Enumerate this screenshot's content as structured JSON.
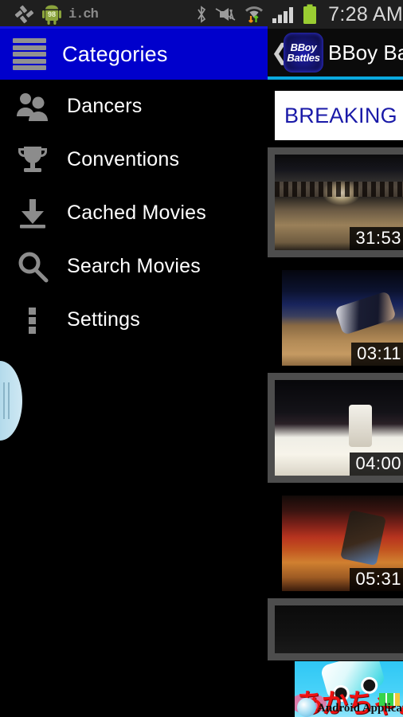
{
  "status_bar": {
    "clock": "7:28 AM",
    "left_icons": [
      {
        "name": "gps-satellite-icon",
        "glyph": "✂"
      },
      {
        "name": "android-update-icon",
        "label": "98"
      },
      {
        "name": "ich-app-icon",
        "label": "i.ch"
      }
    ],
    "right_icons": [
      {
        "name": "bluetooth-icon"
      },
      {
        "name": "vibrate-mute-icon"
      },
      {
        "name": "wifi-transfer-icon"
      },
      {
        "name": "cellular-signal-icon"
      },
      {
        "name": "battery-icon"
      }
    ]
  },
  "sidebar": {
    "title": "Categories",
    "menu_icon": "hamburger-icon",
    "handle": "drawer-pull-handle",
    "items": [
      {
        "label": "Dancers",
        "icon": "people-icon"
      },
      {
        "label": "Conventions",
        "icon": "trophy-icon"
      },
      {
        "label": "Cached Movies",
        "icon": "download-icon"
      },
      {
        "label": "Search Movies",
        "icon": "search-icon"
      },
      {
        "label": "Settings",
        "icon": "vertical-dots-icon"
      }
    ]
  },
  "content": {
    "back_chevron": "❮",
    "app_icon_line1": "BBoy",
    "app_icon_line2": "Battles",
    "title": "BBoy Bat",
    "banner_text": "BREAKING B",
    "videos": [
      {
        "duration": "31:53",
        "thumb": "t1"
      },
      {
        "duration": "03:11",
        "thumb": "t2"
      },
      {
        "duration": "04:00",
        "thumb": "t3"
      },
      {
        "duration": "05:31",
        "thumb": "t4"
      }
    ]
  },
  "ad": {
    "headline": "あかちゃん",
    "subline": "Android Application"
  },
  "colors": {
    "sidebar_header": "#0000cc",
    "content_accent": "#0aa9e0",
    "banner_text": "#1a1aa8",
    "battery": "#9acd32",
    "handle": "#b6dcec"
  }
}
